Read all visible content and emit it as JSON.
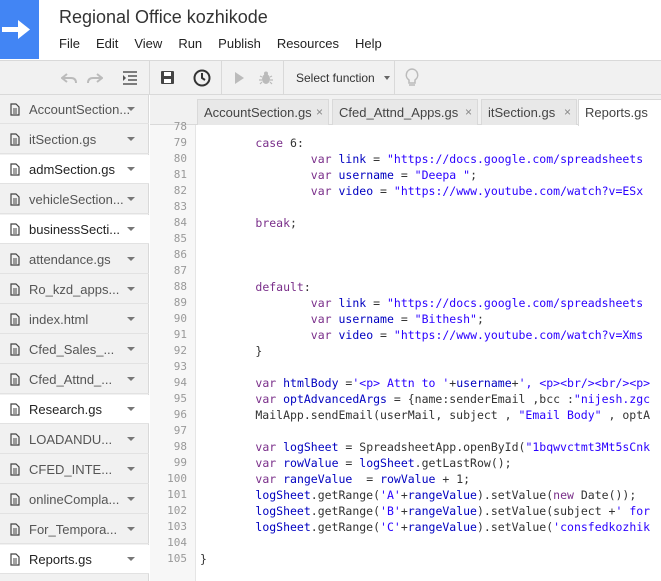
{
  "app": {
    "title": "Regional Office kozhikode"
  },
  "menu": [
    "File",
    "Edit",
    "View",
    "Run",
    "Publish",
    "Resources",
    "Help"
  ],
  "toolbar": {
    "select_function": "Select function"
  },
  "files": [
    {
      "name": "AccountSection...",
      "active": false
    },
    {
      "name": "itSection.gs",
      "active": false
    },
    {
      "name": "admSection.gs",
      "active": true
    },
    {
      "name": "vehicleSection...",
      "active": false
    },
    {
      "name": "businessSecti...",
      "active": true
    },
    {
      "name": "attendance.gs",
      "active": false
    },
    {
      "name": "Ro_kzd_apps...",
      "active": false
    },
    {
      "name": "index.html",
      "active": false
    },
    {
      "name": "Cfed_Sales_...",
      "active": false
    },
    {
      "name": "Cfed_Attnd_...",
      "active": false
    },
    {
      "name": "Research.gs",
      "active": true
    },
    {
      "name": "LOADANDU...",
      "active": false
    },
    {
      "name": "CFED_INTE...",
      "active": false
    },
    {
      "name": "onlineCompla...",
      "active": false
    },
    {
      "name": "For_Tempora...",
      "active": false
    },
    {
      "name": "Reports.gs",
      "active": true
    }
  ],
  "tabs": [
    {
      "label": "AccountSection.gs",
      "close": "×"
    },
    {
      "label": "Cfed_Attnd_Apps.gs",
      "close": "×"
    },
    {
      "label": "itSection.gs",
      "close": "×"
    },
    {
      "label": "Reports.gs",
      "close": "×"
    }
  ],
  "code": {
    "lines": [
      {
        "n": "78",
        "t": ""
      },
      {
        "n": "79",
        "t": "        case 6:"
      },
      {
        "n": "80",
        "t": "                var link = \"https://docs.google.com/spreadsheets"
      },
      {
        "n": "81",
        "t": "                var username = \"Deepa \";"
      },
      {
        "n": "82",
        "t": "                var video = \"https://www.youtube.com/watch?v=ESx"
      },
      {
        "n": "83",
        "t": ""
      },
      {
        "n": "84",
        "t": "        break;"
      },
      {
        "n": "85",
        "t": ""
      },
      {
        "n": "86",
        "t": ""
      },
      {
        "n": "87",
        "t": ""
      },
      {
        "n": "88",
        "t": "        default:"
      },
      {
        "n": "89",
        "t": "                var link = \"https://docs.google.com/spreadsheets"
      },
      {
        "n": "90",
        "t": "                var username = \"Bithesh\";"
      },
      {
        "n": "91",
        "t": "                var video = \"https://www.youtube.com/watch?v=Xms"
      },
      {
        "n": "92",
        "t": "        }"
      },
      {
        "n": "93",
        "t": ""
      },
      {
        "n": "94",
        "t": "        var htmlBody ='<p> Attn to '+username+', <p><br/><br/><p>"
      },
      {
        "n": "95",
        "t": "        var optAdvancedArgs = {name:senderEmail ,bcc :\"nijesh.zgc"
      },
      {
        "n": "96",
        "t": "        MailApp.sendEmail(userMail, subject , \"Email Body\" , optA"
      },
      {
        "n": "97",
        "t": ""
      },
      {
        "n": "98",
        "t": "        var logSheet = SpreadsheetApp.openById(\"1bqwvctmt3Mt5sCnk"
      },
      {
        "n": "99",
        "t": "        var rowValue = logSheet.getLastRow();"
      },
      {
        "n": "100",
        "t": "        var rangeValue  = rowValue + 1;"
      },
      {
        "n": "101",
        "t": "        logSheet.getRange('A'+rangeValue).setValue(new Date());"
      },
      {
        "n": "102",
        "t": "        logSheet.getRange('B'+rangeValue).setValue(subject +' for"
      },
      {
        "n": "103",
        "t": "        logSheet.getRange('C'+rangeValue).setValue('consfedkozhik"
      },
      {
        "n": "104",
        "t": ""
      },
      {
        "n": "105",
        "t": "}"
      }
    ]
  }
}
